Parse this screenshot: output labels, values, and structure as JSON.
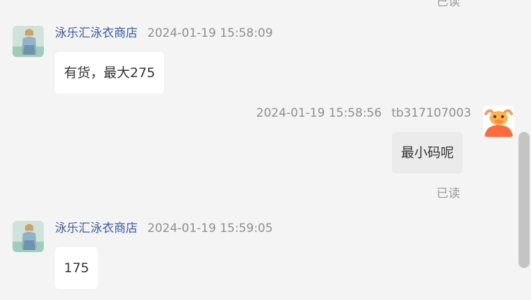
{
  "chat": {
    "top_read_status": "已读",
    "messages": [
      {
        "sender": "泳乐汇泳衣商店",
        "timestamp": "2024-01-19 15:58:09",
        "text": "有货，最大275",
        "direction": "incoming"
      },
      {
        "sender": "tb317107003",
        "timestamp": "2024-01-19 15:58:56",
        "text": "最小码呢",
        "direction": "outgoing",
        "read_status": "已读"
      },
      {
        "sender": "泳乐汇泳衣商店",
        "timestamp": "2024-01-19 15:59:05",
        "text": "175",
        "direction": "incoming"
      }
    ]
  },
  "colors": {
    "background": "#f4f4f4",
    "shop_name": "#3d5aa8",
    "meta_text": "#8f8f8f",
    "incoming_bubble": "#ffffff",
    "outgoing_bubble": "#ebebeb",
    "user_avatar": "#ff7043"
  },
  "icons": {
    "shop_avatar": "shop-avatar-photo",
    "user_avatar": "bull-mascot-avatar"
  }
}
